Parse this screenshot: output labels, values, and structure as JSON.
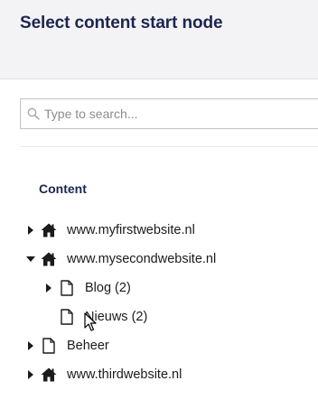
{
  "dialog": {
    "title": "Select content start node"
  },
  "search": {
    "placeholder": "Type to search..."
  },
  "tree": {
    "heading": "Content",
    "items": [
      {
        "label": "www.myfirstwebsite.nl",
        "icon": "home-icon",
        "caret": "right"
      },
      {
        "label": "www.mysecondwebsite.nl",
        "icon": "home-icon",
        "caret": "down"
      },
      {
        "label": "Blog (2)",
        "icon": "document-icon",
        "caret": "right"
      },
      {
        "label": "Nieuws (2)",
        "icon": "document-icon",
        "caret": "none"
      },
      {
        "label": "Beheer",
        "icon": "document-icon",
        "caret": "right"
      },
      {
        "label": "www.thirdwebsite.nl",
        "icon": "home-icon",
        "caret": "right"
      }
    ]
  },
  "colors": {
    "header_bg": "#f3f3f5",
    "title_text": "#1b264f",
    "panel_bg": "#ffffff"
  }
}
